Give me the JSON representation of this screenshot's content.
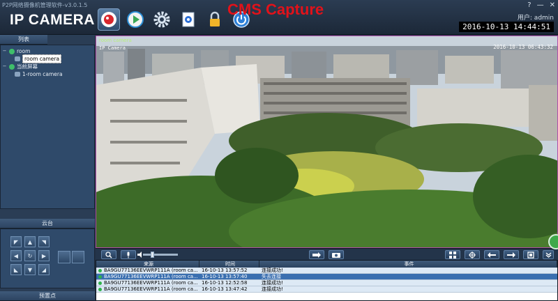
{
  "app": {
    "caption": "P2P网络摄像机管理软件-v3.0.1.5",
    "logo": "IP CAMERA",
    "title": "CMS Capture",
    "help": "?",
    "minimize": "—",
    "close": "✕",
    "user_line": "用户: admin",
    "clock": "2016-10-13 14:44:51"
  },
  "toolbar": {
    "items": [
      {
        "name": "monitor",
        "icon": "camera-lens-icon",
        "active": true
      },
      {
        "name": "playback",
        "icon": "play-icon"
      },
      {
        "name": "settings",
        "icon": "gear-icon"
      },
      {
        "name": "device-config",
        "icon": "document-icon"
      },
      {
        "name": "lock",
        "icon": "lock-icon"
      },
      {
        "name": "power",
        "icon": "power-icon"
      }
    ]
  },
  "left_panel": {
    "list_tab": "列表",
    "tree": [
      {
        "label": "room",
        "level": 0
      },
      {
        "label": "room camera",
        "level": 1,
        "selected": true
      },
      {
        "label": "当前屏幕",
        "level": 0
      },
      {
        "label": "1-room camera",
        "level": 1
      }
    ],
    "ptz_tab": "云台",
    "preset_tab": "预置点",
    "ptz": {
      "up": "▲",
      "down": "▼",
      "left": "◀",
      "right": "▶",
      "up_left": "◤",
      "up_right": "◥",
      "down_left": "◣",
      "down_right": "◢",
      "center": "↻"
    }
  },
  "video": {
    "label": "room camera",
    "osd_name": "IP Camera",
    "osd_time": "2016-10-13 06:43:32"
  },
  "video_controls": {
    "volume_fraction": 0.25
  },
  "log": {
    "columns": [
      "来源",
      "时间",
      "事件"
    ],
    "rows": [
      {
        "source": "BA9GU77136EEVWRP111A (room ca...",
        "time": "16-10-13 13:57:52",
        "event": "连接成功!",
        "selected": false
      },
      {
        "source": "BA9GU77136EEVWRP111A (room ca...",
        "time": "16-10-13 13:57:40",
        "event": "失去连接",
        "selected": true
      },
      {
        "source": "BA9GU77136EEVWRP111A (room ca...",
        "time": "16-10-13 12:52:58",
        "event": "连接成功!",
        "selected": false
      },
      {
        "source": "BA9GU77136EEVWRP111A (room ca...",
        "time": "16-10-13 13:47:42",
        "event": "连接成功!",
        "selected": false
      }
    ]
  },
  "colors": {
    "accent_red": "#e1121a",
    "status_green": "#2fb24a",
    "panel_blue": "#2f4a6a",
    "video_border": "#b04da8"
  }
}
